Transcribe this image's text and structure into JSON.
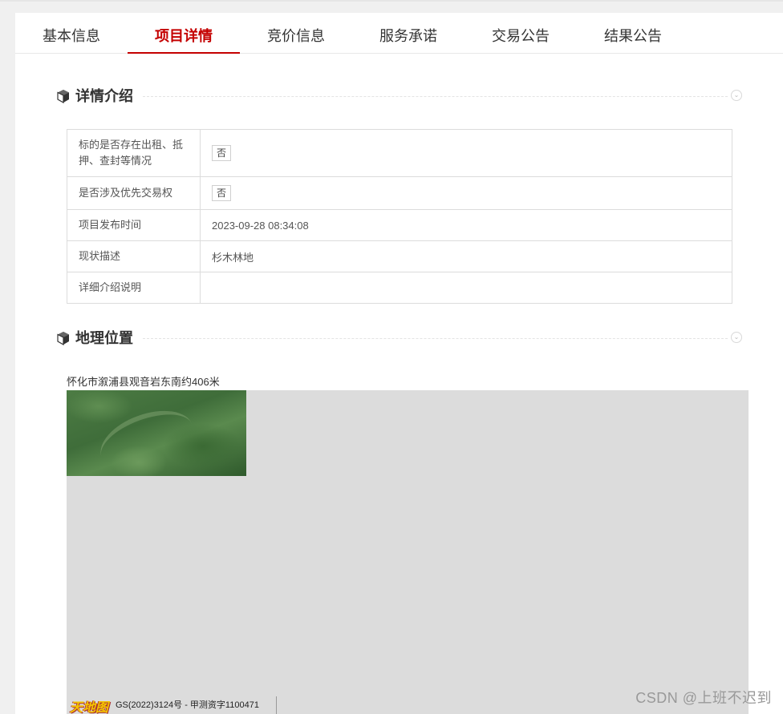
{
  "tabs": [
    {
      "label": "基本信息",
      "active": false
    },
    {
      "label": "项目详情",
      "active": true
    },
    {
      "label": "竞价信息",
      "active": false
    },
    {
      "label": "服务承诺",
      "active": false
    },
    {
      "label": "交易公告",
      "active": false
    },
    {
      "label": "结果公告",
      "active": false
    }
  ],
  "sections": {
    "detail": {
      "title": "详情介绍",
      "icon": "cube-icon"
    },
    "location": {
      "title": "地理位置",
      "icon": "cube-icon"
    }
  },
  "detail_table": {
    "rows": [
      {
        "label": "标的是否存在出租、抵押、查封等情况",
        "value": "否",
        "badge": true
      },
      {
        "label": "是否涉及优先交易权",
        "value": "否",
        "badge": true
      },
      {
        "label": "项目发布时间",
        "value": "2023-09-28 08:34:08",
        "badge": false
      },
      {
        "label": "现状描述",
        "value": "杉木林地",
        "badge": false
      },
      {
        "label": "详细介绍说明",
        "value": "",
        "badge": false
      }
    ]
  },
  "location": {
    "address": "怀化市溆浦县观音岩东南约406米",
    "map": {
      "logo_text": "天地图",
      "license": "GS(2022)3124号 - 甲测资字1100471"
    }
  },
  "watermark": "CSDN @上班不迟到",
  "colors": {
    "accent": "#c40000",
    "border": "#dcdcdc",
    "map_bg": "#dcdcdc"
  }
}
